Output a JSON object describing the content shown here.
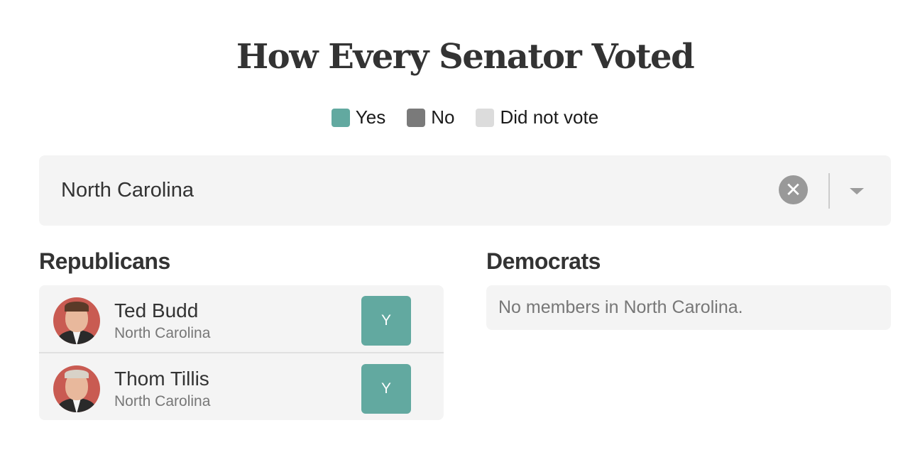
{
  "title": "How Every Senator Voted",
  "legend": [
    {
      "label": "Yes",
      "color": "#62a9a0"
    },
    {
      "label": "No",
      "color": "#7a7a7a"
    },
    {
      "label": "Did not vote",
      "color": "#dcdcdc"
    }
  ],
  "state_select": {
    "value": "North Carolina",
    "clear_icon": "x-circle-icon",
    "dropdown_icon": "caret-down-icon"
  },
  "republicans": {
    "heading": "Republicans",
    "members": [
      {
        "name": "Ted Budd",
        "state": "North Carolina",
        "vote": "Y"
      },
      {
        "name": "Thom Tillis",
        "state": "North Carolina",
        "vote": "Y"
      }
    ]
  },
  "democrats": {
    "heading": "Democrats",
    "empty_message": "No members in North Carolina."
  },
  "colors": {
    "yes": "#62a9a0",
    "republican_avatar_bg": "#c95b52",
    "panel_bg": "#f4f4f4"
  }
}
